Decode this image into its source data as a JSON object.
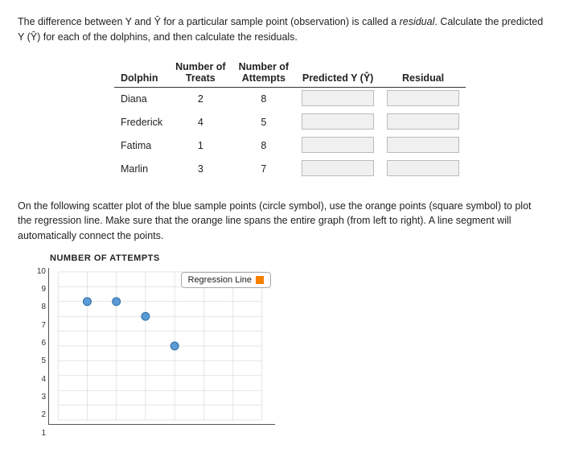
{
  "intro": {
    "text1": "The difference between Y and Ŷ for a particular sample point (observation) is called a ",
    "italic": "residual",
    "text2": ". Calculate the predicted Y (Ŷ) for each of the dolphins, and then calculate the residuals."
  },
  "table": {
    "headers": {
      "dolphin": "Dolphin",
      "treats": "Number of\nTreats",
      "attempts": "Number of\nAttempts",
      "predicted": "Predicted Y (Ŷ)",
      "residual": "Residual"
    },
    "rows": [
      {
        "dolphin": "Diana",
        "treats": "2",
        "attempts": "8"
      },
      {
        "dolphin": "Frederick",
        "treats": "4",
        "attempts": "5"
      },
      {
        "dolphin": "Fatima",
        "treats": "1",
        "attempts": "8"
      },
      {
        "dolphin": "Marlin",
        "treats": "3",
        "attempts": "7"
      }
    ]
  },
  "scatter": {
    "intro": "On the following scatter plot of the blue sample points (circle symbol), use the orange points (square symbol) to plot the regression line. Make sure that the orange line spans the entire graph (from left to right). A line segment will automatically connect the points.",
    "chart_title": "NUMBER OF ATTEMPTS",
    "y_labels": [
      "1",
      "2",
      "3",
      "4",
      "5",
      "6",
      "7",
      "8",
      "9",
      "10"
    ],
    "legend": {
      "label": "Regression Line"
    },
    "data_points": [
      {
        "x": 1,
        "y": 8,
        "type": "circle"
      },
      {
        "x": 2,
        "y": 8,
        "type": "circle"
      },
      {
        "x": 3,
        "y": 7,
        "type": "circle"
      },
      {
        "x": 4,
        "y": 5,
        "type": "circle"
      }
    ]
  }
}
